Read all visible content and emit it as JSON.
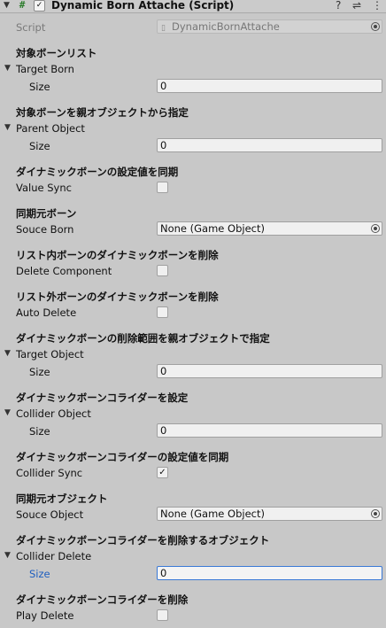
{
  "component": {
    "title": "Dynamic Born Attache (Script)",
    "script_label": "Script",
    "script_value": "DynamicBornAttache",
    "icons": [
      "help-icon",
      "preset-icon",
      "more-icon"
    ]
  },
  "sections": {
    "s1": {
      "header": "対象ボーンリスト",
      "fold_label": "Target Born",
      "size_label": "Size",
      "size_value": "0"
    },
    "s2": {
      "header": "対象ボーンを親オブジェクトから指定",
      "fold_label": "Parent Object",
      "size_label": "Size",
      "size_value": "0"
    },
    "s3": {
      "header": "ダイナミックボーンの設定値を同期",
      "label": "Value Sync",
      "checked": false
    },
    "s4": {
      "header": "同期元ボーン",
      "label": "Souce Born",
      "value": "None (Game Object)"
    },
    "s5": {
      "header": "リスト内ボーンのダイナミックボーンを削除",
      "label": "Delete Component",
      "checked": false
    },
    "s6": {
      "header": "リスト外ボーンのダイナミックボーンを削除",
      "label": "Auto Delete",
      "checked": false
    },
    "s7": {
      "header": "ダイナミックボーンの削除範囲を親オブジェクトで指定",
      "fold_label": "Target Object",
      "size_label": "Size",
      "size_value": "0"
    },
    "s8": {
      "header": "ダイナミックボーンコライダーを設定",
      "fold_label": "Collider Object",
      "size_label": "Size",
      "size_value": "0"
    },
    "s9": {
      "header": "ダイナミックボーンコライダーの設定値を同期",
      "label": "Collider Sync",
      "checked": true,
      "check_glyph": "✓"
    },
    "s10": {
      "header": "同期元オブジェクト",
      "label": "Souce Object",
      "value": "None (Game Object)"
    },
    "s11": {
      "header": "ダイナミックボーンコライダーを削除するオブジェクト",
      "fold_label": "Collider Delete",
      "size_label": "Size",
      "size_value": "0"
    },
    "s12": {
      "header": "ダイナミックボーンコライダーを削除",
      "label": "Play Delete",
      "checked": false
    }
  }
}
